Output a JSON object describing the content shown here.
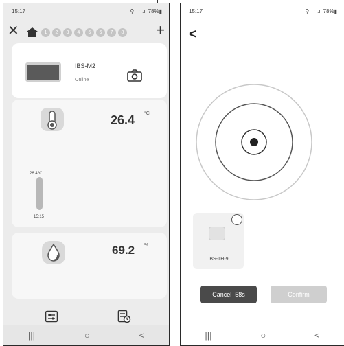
{
  "left_screen": {
    "status": {
      "time": "15:17",
      "system": "⚲ ⌔ .ıl 78%▮"
    },
    "tabs": [
      "1",
      "2",
      "3",
      "4",
      "5",
      "6",
      "7",
      "8"
    ],
    "device": {
      "name": "IBS-M2",
      "status": "Online"
    },
    "temperature": {
      "value": "26.4",
      "unit": "°C",
      "bar_label": "26.4℃",
      "time_label": "15:15"
    },
    "humidity": {
      "value": "69.2",
      "unit": "%"
    },
    "nav": {
      "recents": "|||",
      "home": "○",
      "back": "<"
    }
  },
  "right_screen": {
    "status": {
      "time": "15:17",
      "system": "⚲ ⌔ .ıl 78%▮"
    },
    "candidate_device": {
      "label": "IBS-TH-9"
    },
    "cancel_label": "Cancel",
    "countdown": "58s",
    "confirm_label": "Confirm",
    "nav": {
      "recents": "|||",
      "home": "○",
      "back": "<"
    }
  },
  "colors": {
    "accent_dark": "#4a4a4a",
    "disabled": "#cfcfcf",
    "card_bg": "#f7f7f7"
  },
  "icons": [
    "close-icon",
    "home-icon",
    "plus-icon",
    "camera-icon",
    "thermometer-icon",
    "humidity-drop-icon",
    "settings-sliders-icon",
    "history-report-icon",
    "back-arrow-icon",
    "radar-scan-icon"
  ]
}
